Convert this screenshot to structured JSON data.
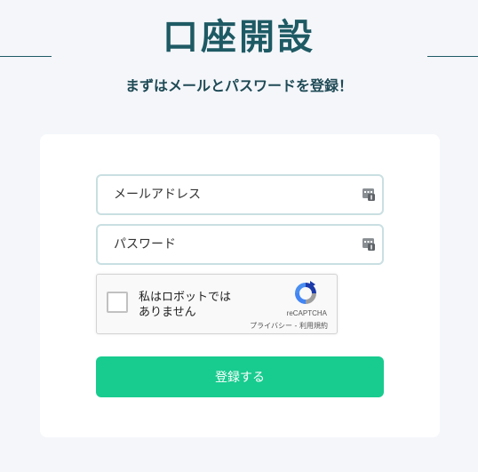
{
  "header": {
    "title": "口座開設",
    "subtitle": "まずはメールとパスワードを登録！"
  },
  "form": {
    "email_placeholder": "メールアドレス",
    "email_value": "",
    "password_placeholder": "パスワード",
    "password_value": "",
    "submit_label": "登録する"
  },
  "recaptcha": {
    "label": "私はロボットではありません",
    "brand": "reCAPTCHA",
    "privacy_link": "プライバシー",
    "separator": " - ",
    "terms_link": "利用規約",
    "checked": false
  },
  "icons": {
    "password_manager": "password-manager-icon",
    "recaptcha_logo": "recaptcha-logo-icon"
  },
  "colors": {
    "background": "#f4f6fa",
    "title": "#1e5a64",
    "field_border": "#c9dfe2",
    "submit": "#18cb8f"
  }
}
